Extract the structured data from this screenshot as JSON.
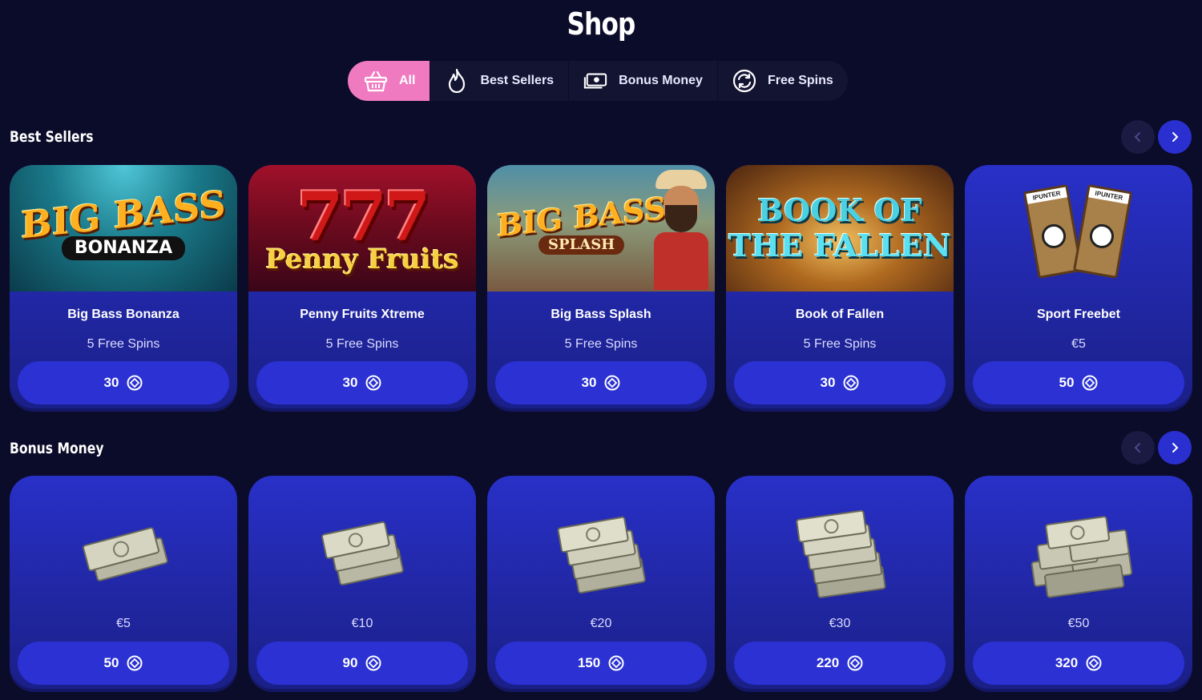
{
  "page": {
    "title": "Shop"
  },
  "tabs": [
    {
      "label": "All",
      "icon": "basket-icon",
      "active": true
    },
    {
      "label": "Best Sellers",
      "icon": "flame-icon",
      "active": false
    },
    {
      "label": "Bonus Money",
      "icon": "banknote-icon",
      "active": false
    },
    {
      "label": "Free Spins",
      "icon": "refresh-icon",
      "active": false
    }
  ],
  "sections": {
    "best_sellers": {
      "title": "Best Sellers",
      "cards": [
        {
          "name": "Big Bass Bonanza",
          "sub": "5 Free Spins",
          "price": "30",
          "logo_top": "BIG BASS",
          "logo_bottom": "BONANZA"
        },
        {
          "name": "Penny Fruits Xtreme",
          "sub": "5 Free Spins",
          "price": "30",
          "logo_top": "777",
          "logo_bottom": "Penny Fruits"
        },
        {
          "name": "Big Bass Splash",
          "sub": "5 Free Spins",
          "price": "30",
          "logo_top": "BIG BASS",
          "logo_bottom": "SPLASH"
        },
        {
          "name": "Book of Fallen",
          "sub": "5 Free Spins",
          "price": "30",
          "logo_top": "BOOK OF",
          "logo_bottom": "THE FALLEN"
        },
        {
          "name": "Sport Freebet",
          "sub": "€5",
          "price": "50",
          "logo_top": "IPUNTER",
          "logo_bottom": "IPUNTER"
        }
      ]
    },
    "bonus_money": {
      "title": "Bonus Money",
      "cards": [
        {
          "sub": "€5",
          "price": "50"
        },
        {
          "sub": "€10",
          "price": "90"
        },
        {
          "sub": "€20",
          "price": "150"
        },
        {
          "sub": "€30",
          "price": "220"
        },
        {
          "sub": "€50",
          "price": "320"
        }
      ]
    }
  },
  "colors": {
    "background": "#0b0b2a",
    "accent_pink": "#f07ac0",
    "card_blue": "#2830c8",
    "button_blue": "#2b31d2"
  }
}
